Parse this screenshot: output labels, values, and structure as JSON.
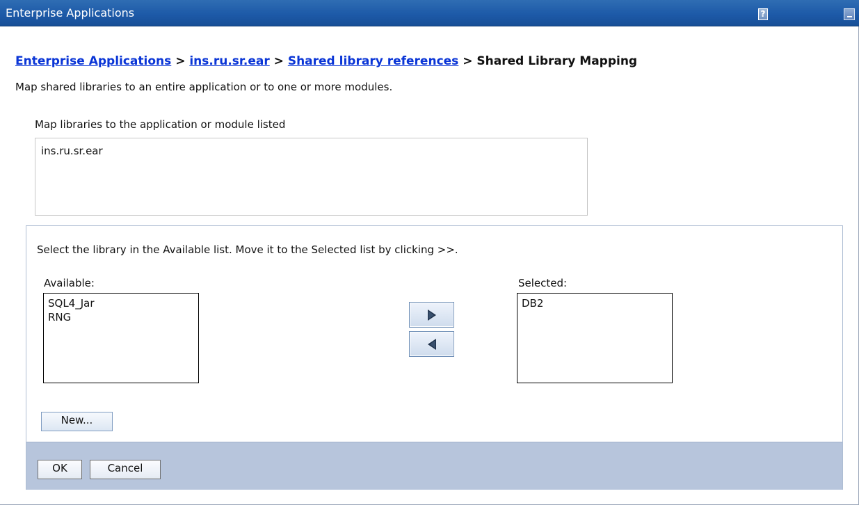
{
  "window": {
    "title": "Enterprise Applications",
    "help_label": "?"
  },
  "breadcrumb": {
    "items": [
      "Enterprise Applications",
      "ins.ru.sr.ear",
      "Shared library references",
      "Shared Library Mapping"
    ],
    "separator": ">"
  },
  "page": {
    "description": "Map shared libraries to an entire application or to one or more modules."
  },
  "mapping": {
    "label": "Map libraries to the application or module listed",
    "items": [
      "ins.ru.sr.ear"
    ]
  },
  "library_selector": {
    "instructions": "Select the library in the Available list. Move it to the Selected list by clicking >>.",
    "available_label": "Available:",
    "available_items": [
      "SQL4_Jar",
      "RNG"
    ],
    "selected_label": "Selected:",
    "selected_items": [
      "DB2"
    ],
    "new_button_label": "New..."
  },
  "footer": {
    "ok_label": "OK",
    "cancel_label": "Cancel"
  },
  "icons": {
    "move_right": "arrow-right-icon",
    "move_left": "arrow-left-icon",
    "help": "help-icon",
    "minimize": "minimize-icon"
  },
  "colors": {
    "titlebar": "#1d5aa8",
    "link": "#0a35d6",
    "footer": "#b7c5dc",
    "panel_border": "#aebdd3"
  }
}
